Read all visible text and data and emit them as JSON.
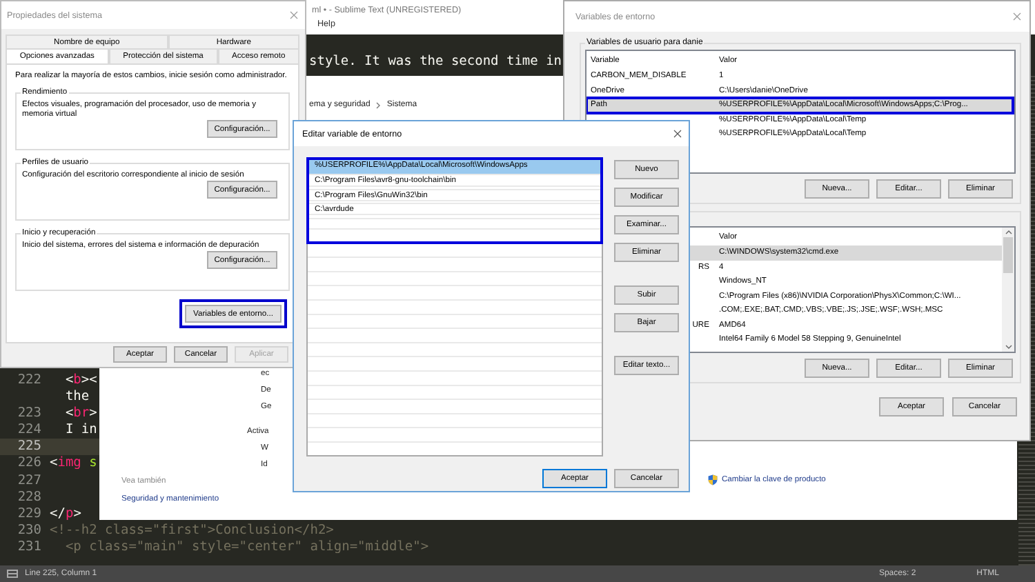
{
  "editor": {
    "title": "ml • - Sublime Text (UNREGISTERED)",
    "menu": [
      "Help"
    ],
    "visible_line": "style. It was the second time in",
    "lines": [
      {
        "number": "222",
        "current": false,
        "tokens": [
          {
            "text": "  <",
            "kind": "punct"
          },
          {
            "text": "b",
            "kind": "tag"
          },
          {
            "text": "><",
            "kind": "punct"
          }
        ]
      },
      {
        "current": false,
        "tokens": [
          {
            "text": "  the",
            "kind": "plain"
          }
        ]
      },
      {
        "number": "223",
        "current": false,
        "tokens": [
          {
            "text": "  <",
            "kind": "punct"
          },
          {
            "text": "br",
            "kind": "tag"
          },
          {
            "text": ">",
            "kind": "punct"
          }
        ]
      },
      {
        "number": "224",
        "current": false,
        "tokens": [
          {
            "text": "  I in",
            "kind": "plain"
          }
        ]
      },
      {
        "number": "225",
        "current": true
      },
      {
        "number": "226",
        "current": false,
        "tokens": [
          {
            "text": "<",
            "kind": "punct"
          },
          {
            "text": "img",
            "kind": "tag"
          },
          {
            "text": " s",
            "kind": "attr"
          }
        ]
      },
      {
        "number": "227",
        "current": false
      },
      {
        "number": "228",
        "current": false
      },
      {
        "number": "229",
        "current": false,
        "tokens": [
          {
            "text": "</",
            "kind": "punct"
          },
          {
            "text": "p",
            "kind": "tag"
          },
          {
            "text": ">",
            "kind": "punct"
          }
        ]
      },
      {
        "number": "230",
        "current": false,
        "tokens": [
          {
            "text": "<!--h2 class=\"first\">Conclusion</h2>",
            "kind": "comment"
          }
        ]
      },
      {
        "number": "231",
        "current": false,
        "tokens": [
          {
            "text": "  <p class=\"main\" style=\"center\" align=\"middle\">",
            "kind": "comment"
          }
        ]
      }
    ],
    "status_bar": {
      "position": "Line 225, Column 1",
      "indentation": "Spaces: 2",
      "syntax": "HTML"
    }
  },
  "control_panel": {
    "breadcrumb": [
      "ema y seguridad",
      "Sistema"
    ],
    "fragments": [
      {
        "text": "ec",
        "kind": "item"
      },
      {
        "text": "De",
        "kind": "item"
      },
      {
        "text": "Ge",
        "kind": "item"
      },
      {
        "text": "Activa",
        "kind": "heading"
      },
      {
        "text": "W",
        "kind": "item"
      },
      {
        "text": "Id",
        "kind": "item"
      }
    ],
    "see_also": {
      "heading": "Vea también",
      "links": [
        "Seguridad y mantenimiento"
      ]
    },
    "product_key_link": "Cambiar la clave de producto"
  },
  "system_properties": {
    "title": "Propiedades del sistema",
    "tab_rows": [
      [
        {
          "label": "Nombre de equipo",
          "selected": false
        },
        {
          "label": "Hardware",
          "selected": false
        }
      ],
      [
        {
          "label": "Opciones avanzadas",
          "selected": true
        },
        {
          "label": "Protección del sistema",
          "selected": false
        },
        {
          "label": "Acceso remoto",
          "selected": false
        }
      ]
    ],
    "notice": "Para realizar la mayoría de estos cambios, inicie sesión como administrador.",
    "groups": [
      {
        "title": "Rendimiento",
        "text": "Efectos visuales, programación del procesador, uso de memoria y memoria virtual",
        "button": "Configuración..."
      },
      {
        "title": "Perfiles de usuario",
        "text": "Configuración del escritorio correspondiente al inicio de sesión",
        "button": "Configuración..."
      },
      {
        "title": "Inicio y recuperación",
        "text": "Inicio del sistema, errores del sistema e información de depuración",
        "button": "Configuración..."
      }
    ],
    "env_button": {
      "label": "Variables de entorno...",
      "highlighted": true
    },
    "buttons": [
      {
        "label": "Aceptar",
        "disabled": false
      },
      {
        "label": "Cancelar",
        "disabled": false
      },
      {
        "label": "Aplicar",
        "disabled": true
      }
    ]
  },
  "environment_variables": {
    "title": "Variables de entorno",
    "user_group": {
      "title": "Variables de usuario para danie",
      "columns": [
        {
          "label": "Variable",
          "kind": "name"
        },
        {
          "label": "Valor",
          "kind": "value"
        }
      ],
      "rows": [
        {
          "variable": "CARBON_MEM_DISABLE",
          "value": "1",
          "selected": false,
          "highlighted": false
        },
        {
          "variable": "OneDrive",
          "value": "C:\\Users\\danie\\OneDrive",
          "selected": false,
          "highlighted": false
        },
        {
          "variable": "Path",
          "value": "%USERPROFILE%\\AppData\\Local\\Microsoft\\WindowsApps;C:\\Prog...",
          "selected": true,
          "highlighted": true
        },
        {
          "value": "%USERPROFILE%\\AppData\\Local\\Temp",
          "selected": false,
          "highlighted": false
        },
        {
          "value": "%USERPROFILE%\\AppData\\Local\\Temp",
          "selected": false,
          "highlighted": false
        }
      ],
      "buttons": [
        "Nueva...",
        "Editar...",
        "Eliminar"
      ]
    },
    "system_group": {
      "columns": [
        {
          "label": "Valor",
          "kind": "value"
        }
      ],
      "rows": [
        {
          "value": "C:\\WINDOWS\\system32\\cmd.exe",
          "selected": true,
          "highlighted": false
        },
        {
          "variable": "RS",
          "value": "4",
          "selected": false,
          "highlighted": false
        },
        {
          "value": "Windows_NT",
          "selected": false,
          "highlighted": false
        },
        {
          "value": "C:\\Program Files (x86)\\NVIDIA Corporation\\PhysX\\Common;C:\\WI...",
          "selected": false,
          "highlighted": false
        },
        {
          "value": ".COM;.EXE;.BAT;.CMD;.VBS;.VBE;.JS;.JSE;.WSF;.WSH;.MSC",
          "selected": false,
          "highlighted": false
        },
        {
          "variable": "URE",
          "value": "AMD64",
          "selected": false,
          "highlighted": false
        },
        {
          "value": "Intel64 Family 6 Model 58 Stepping 9, GenuineIntel",
          "selected": false,
          "highlighted": false
        }
      ],
      "buttons": [
        "Nueva...",
        "Editar...",
        "Eliminar"
      ]
    },
    "buttons": [
      "Aceptar",
      "Cancelar"
    ]
  },
  "edit_variable": {
    "title": "Editar variable de entorno",
    "highlighted": true,
    "entries": [
      {
        "text": "%USERPROFILE%\\AppData\\Local\\Microsoft\\WindowsApps",
        "selected": true
      },
      {
        "text": "C:\\Program Files\\avr8-gnu-toolchain\\bin",
        "selected": false
      },
      {
        "text": "C:\\Program Files\\GnuWin32\\bin",
        "selected": false
      },
      {
        "text": "C:\\avrdude",
        "selected": false
      }
    ],
    "button_groups": [
      [
        "Nuevo",
        "Modificar",
        "Examinar...",
        "Eliminar"
      ],
      [
        "Subir",
        "Bajar"
      ],
      [
        "Editar texto..."
      ]
    ],
    "buttons": [
      {
        "label": "Aceptar",
        "default": true
      },
      {
        "label": "Cancelar",
        "default": false
      }
    ]
  }
}
